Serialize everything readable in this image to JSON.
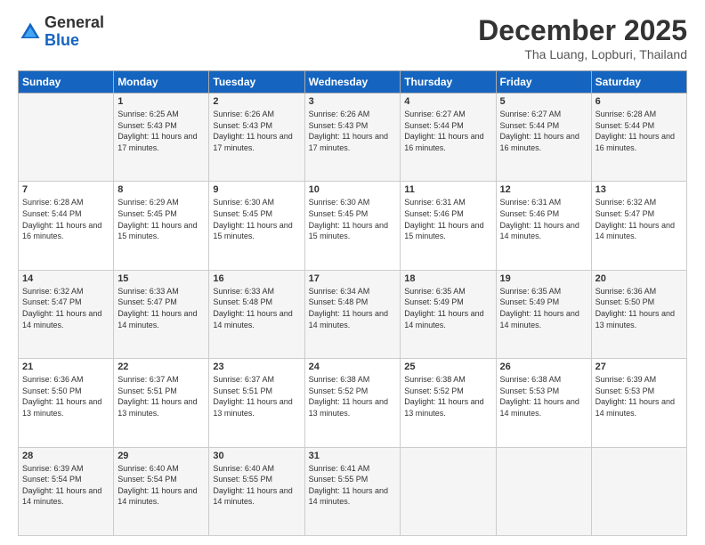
{
  "logo": {
    "general": "General",
    "blue": "Blue"
  },
  "header": {
    "month": "December 2025",
    "location": "Tha Luang, Lopburi, Thailand"
  },
  "days_of_week": [
    "Sunday",
    "Monday",
    "Tuesday",
    "Wednesday",
    "Thursday",
    "Friday",
    "Saturday"
  ],
  "weeks": [
    [
      {
        "day": "",
        "sunrise": "",
        "sunset": "",
        "daylight": ""
      },
      {
        "day": "1",
        "sunrise": "Sunrise: 6:25 AM",
        "sunset": "Sunset: 5:43 PM",
        "daylight": "Daylight: 11 hours and 17 minutes."
      },
      {
        "day": "2",
        "sunrise": "Sunrise: 6:26 AM",
        "sunset": "Sunset: 5:43 PM",
        "daylight": "Daylight: 11 hours and 17 minutes."
      },
      {
        "day": "3",
        "sunrise": "Sunrise: 6:26 AM",
        "sunset": "Sunset: 5:43 PM",
        "daylight": "Daylight: 11 hours and 17 minutes."
      },
      {
        "day": "4",
        "sunrise": "Sunrise: 6:27 AM",
        "sunset": "Sunset: 5:44 PM",
        "daylight": "Daylight: 11 hours and 16 minutes."
      },
      {
        "day": "5",
        "sunrise": "Sunrise: 6:27 AM",
        "sunset": "Sunset: 5:44 PM",
        "daylight": "Daylight: 11 hours and 16 minutes."
      },
      {
        "day": "6",
        "sunrise": "Sunrise: 6:28 AM",
        "sunset": "Sunset: 5:44 PM",
        "daylight": "Daylight: 11 hours and 16 minutes."
      }
    ],
    [
      {
        "day": "7",
        "sunrise": "Sunrise: 6:28 AM",
        "sunset": "Sunset: 5:44 PM",
        "daylight": "Daylight: 11 hours and 16 minutes."
      },
      {
        "day": "8",
        "sunrise": "Sunrise: 6:29 AM",
        "sunset": "Sunset: 5:45 PM",
        "daylight": "Daylight: 11 hours and 15 minutes."
      },
      {
        "day": "9",
        "sunrise": "Sunrise: 6:30 AM",
        "sunset": "Sunset: 5:45 PM",
        "daylight": "Daylight: 11 hours and 15 minutes."
      },
      {
        "day": "10",
        "sunrise": "Sunrise: 6:30 AM",
        "sunset": "Sunset: 5:45 PM",
        "daylight": "Daylight: 11 hours and 15 minutes."
      },
      {
        "day": "11",
        "sunrise": "Sunrise: 6:31 AM",
        "sunset": "Sunset: 5:46 PM",
        "daylight": "Daylight: 11 hours and 15 minutes."
      },
      {
        "day": "12",
        "sunrise": "Sunrise: 6:31 AM",
        "sunset": "Sunset: 5:46 PM",
        "daylight": "Daylight: 11 hours and 14 minutes."
      },
      {
        "day": "13",
        "sunrise": "Sunrise: 6:32 AM",
        "sunset": "Sunset: 5:47 PM",
        "daylight": "Daylight: 11 hours and 14 minutes."
      }
    ],
    [
      {
        "day": "14",
        "sunrise": "Sunrise: 6:32 AM",
        "sunset": "Sunset: 5:47 PM",
        "daylight": "Daylight: 11 hours and 14 minutes."
      },
      {
        "day": "15",
        "sunrise": "Sunrise: 6:33 AM",
        "sunset": "Sunset: 5:47 PM",
        "daylight": "Daylight: 11 hours and 14 minutes."
      },
      {
        "day": "16",
        "sunrise": "Sunrise: 6:33 AM",
        "sunset": "Sunset: 5:48 PM",
        "daylight": "Daylight: 11 hours and 14 minutes."
      },
      {
        "day": "17",
        "sunrise": "Sunrise: 6:34 AM",
        "sunset": "Sunset: 5:48 PM",
        "daylight": "Daylight: 11 hours and 14 minutes."
      },
      {
        "day": "18",
        "sunrise": "Sunrise: 6:35 AM",
        "sunset": "Sunset: 5:49 PM",
        "daylight": "Daylight: 11 hours and 14 minutes."
      },
      {
        "day": "19",
        "sunrise": "Sunrise: 6:35 AM",
        "sunset": "Sunset: 5:49 PM",
        "daylight": "Daylight: 11 hours and 14 minutes."
      },
      {
        "day": "20",
        "sunrise": "Sunrise: 6:36 AM",
        "sunset": "Sunset: 5:50 PM",
        "daylight": "Daylight: 11 hours and 13 minutes."
      }
    ],
    [
      {
        "day": "21",
        "sunrise": "Sunrise: 6:36 AM",
        "sunset": "Sunset: 5:50 PM",
        "daylight": "Daylight: 11 hours and 13 minutes."
      },
      {
        "day": "22",
        "sunrise": "Sunrise: 6:37 AM",
        "sunset": "Sunset: 5:51 PM",
        "daylight": "Daylight: 11 hours and 13 minutes."
      },
      {
        "day": "23",
        "sunrise": "Sunrise: 6:37 AM",
        "sunset": "Sunset: 5:51 PM",
        "daylight": "Daylight: 11 hours and 13 minutes."
      },
      {
        "day": "24",
        "sunrise": "Sunrise: 6:38 AM",
        "sunset": "Sunset: 5:52 PM",
        "daylight": "Daylight: 11 hours and 13 minutes."
      },
      {
        "day": "25",
        "sunrise": "Sunrise: 6:38 AM",
        "sunset": "Sunset: 5:52 PM",
        "daylight": "Daylight: 11 hours and 13 minutes."
      },
      {
        "day": "26",
        "sunrise": "Sunrise: 6:38 AM",
        "sunset": "Sunset: 5:53 PM",
        "daylight": "Daylight: 11 hours and 14 minutes."
      },
      {
        "day": "27",
        "sunrise": "Sunrise: 6:39 AM",
        "sunset": "Sunset: 5:53 PM",
        "daylight": "Daylight: 11 hours and 14 minutes."
      }
    ],
    [
      {
        "day": "28",
        "sunrise": "Sunrise: 6:39 AM",
        "sunset": "Sunset: 5:54 PM",
        "daylight": "Daylight: 11 hours and 14 minutes."
      },
      {
        "day": "29",
        "sunrise": "Sunrise: 6:40 AM",
        "sunset": "Sunset: 5:54 PM",
        "daylight": "Daylight: 11 hours and 14 minutes."
      },
      {
        "day": "30",
        "sunrise": "Sunrise: 6:40 AM",
        "sunset": "Sunset: 5:55 PM",
        "daylight": "Daylight: 11 hours and 14 minutes."
      },
      {
        "day": "31",
        "sunrise": "Sunrise: 6:41 AM",
        "sunset": "Sunset: 5:55 PM",
        "daylight": "Daylight: 11 hours and 14 minutes."
      },
      {
        "day": "",
        "sunrise": "",
        "sunset": "",
        "daylight": ""
      },
      {
        "day": "",
        "sunrise": "",
        "sunset": "",
        "daylight": ""
      },
      {
        "day": "",
        "sunrise": "",
        "sunset": "",
        "daylight": ""
      }
    ]
  ]
}
